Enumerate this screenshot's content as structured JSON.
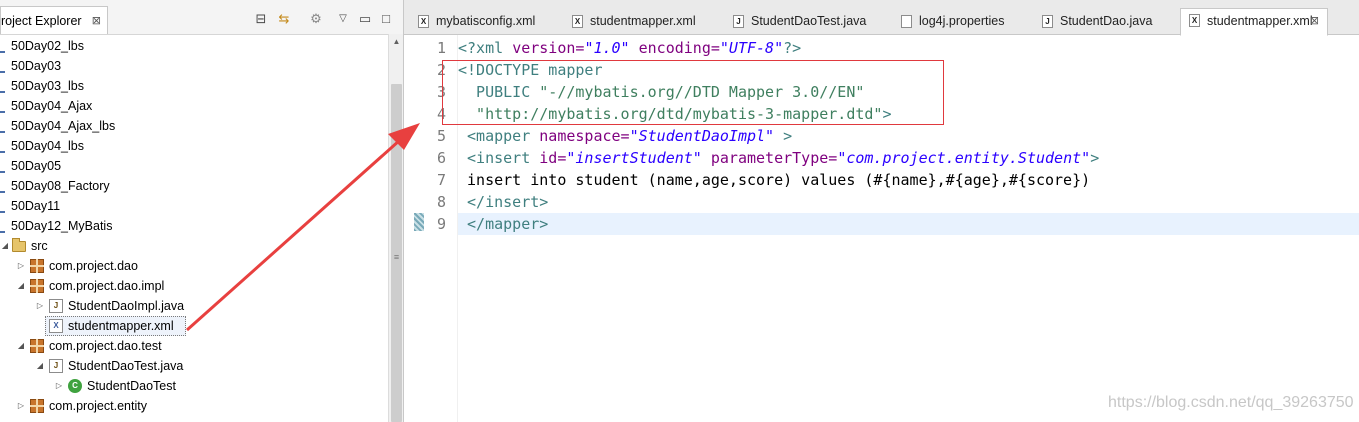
{
  "project_explorer": {
    "title": "roject Explorer",
    "close_label": "⊠",
    "toolbar": [
      "collapse-all-icon",
      "link-editor-icon",
      "filter-icon",
      "view-menu-icon",
      "minimize-icon",
      "maximize-icon"
    ],
    "items": [
      {
        "label": "50Day02_lbs",
        "type": "project"
      },
      {
        "label": "50Day03",
        "type": "project"
      },
      {
        "label": "50Day03_lbs",
        "type": "project"
      },
      {
        "label": "50Day04_Ajax",
        "type": "project"
      },
      {
        "label": "50Day04_Ajax_lbs",
        "type": "project"
      },
      {
        "label": "50Day04_lbs",
        "type": "project"
      },
      {
        "label": "50Day05",
        "type": "project"
      },
      {
        "label": "50Day08_Factory",
        "type": "project"
      },
      {
        "label": "50Day11",
        "type": "project"
      },
      {
        "label": "50Day12_MyBatis",
        "type": "project"
      },
      {
        "label": "src",
        "type": "folder",
        "twisty": "◢"
      },
      {
        "label": "com.project.dao",
        "type": "package",
        "twisty": "▷"
      },
      {
        "label": "com.project.dao.impl",
        "type": "package",
        "twisty": "◢"
      },
      {
        "label": "StudentDaoImpl.java",
        "type": "java",
        "twisty": "▷"
      },
      {
        "label": "studentmapper.xml",
        "type": "xml",
        "selected": true
      },
      {
        "label": "com.project.dao.test",
        "type": "package",
        "twisty": "◢"
      },
      {
        "label": "StudentDaoTest.java",
        "type": "java",
        "twisty": "◢"
      },
      {
        "label": "StudentDaoTest",
        "type": "class",
        "twisty": "▷"
      },
      {
        "label": "com.project.entity",
        "type": "package",
        "twisty": "▷"
      }
    ]
  },
  "editor": {
    "tabs": [
      {
        "label": "mybatisconfig.xml",
        "icon": "X"
      },
      {
        "label": "studentmapper.xml",
        "icon": "X"
      },
      {
        "label": "StudentDaoTest.java",
        "icon": "J"
      },
      {
        "label": "log4j.properties",
        "icon": ""
      },
      {
        "label": "StudentDao.java",
        "icon": "J"
      },
      {
        "label": "studentmapper.xml",
        "icon": "X",
        "active": true
      }
    ],
    "tab_close": "⊠",
    "line_numbers": [
      "1",
      "2",
      "3",
      "4",
      "5",
      "6",
      "7",
      "8",
      "9"
    ],
    "lines": {
      "l1": {
        "open": "<?xml ",
        "a1": "version=",
        "v1": "\"1.0\"",
        "a2": " encoding=",
        "v2": "\"UTF-8\"",
        "close": "?>"
      },
      "l2": {
        "text": "<!DOCTYPE mapper"
      },
      "l3": {
        "kw": "  PUBLIC ",
        "v": "\"-//mybatis.org//DTD Mapper 3.0//EN\""
      },
      "l4": {
        "v": "  \"http://mybatis.org/dtd/mybatis-3-mapper.dtd\"",
        "close": ">"
      },
      "l5": {
        "open": " <mapper ",
        "a1": "namespace=",
        "v1": "\"StudentDaoImpl\"",
        "close": " >"
      },
      "l6": {
        "open": " <insert ",
        "a1": "id=",
        "v1": "\"insertStudent\"",
        "a2": " parameterType=",
        "v2": "\"com.project.entity.Student\"",
        "close": ">"
      },
      "l7": {
        "text": " insert into student (name,age,score) values (#{name},#{age},#{score})"
      },
      "l8": {
        "text": " </insert>"
      },
      "l9": {
        "text": " </mapper>"
      }
    }
  },
  "watermark": "https://blog.csdn.net/qq_39263750",
  "colors": {
    "annotation_red": "#e0393e",
    "tag": "#3f7f7f",
    "attr": "#7f007f",
    "string": "#2a00ff"
  }
}
